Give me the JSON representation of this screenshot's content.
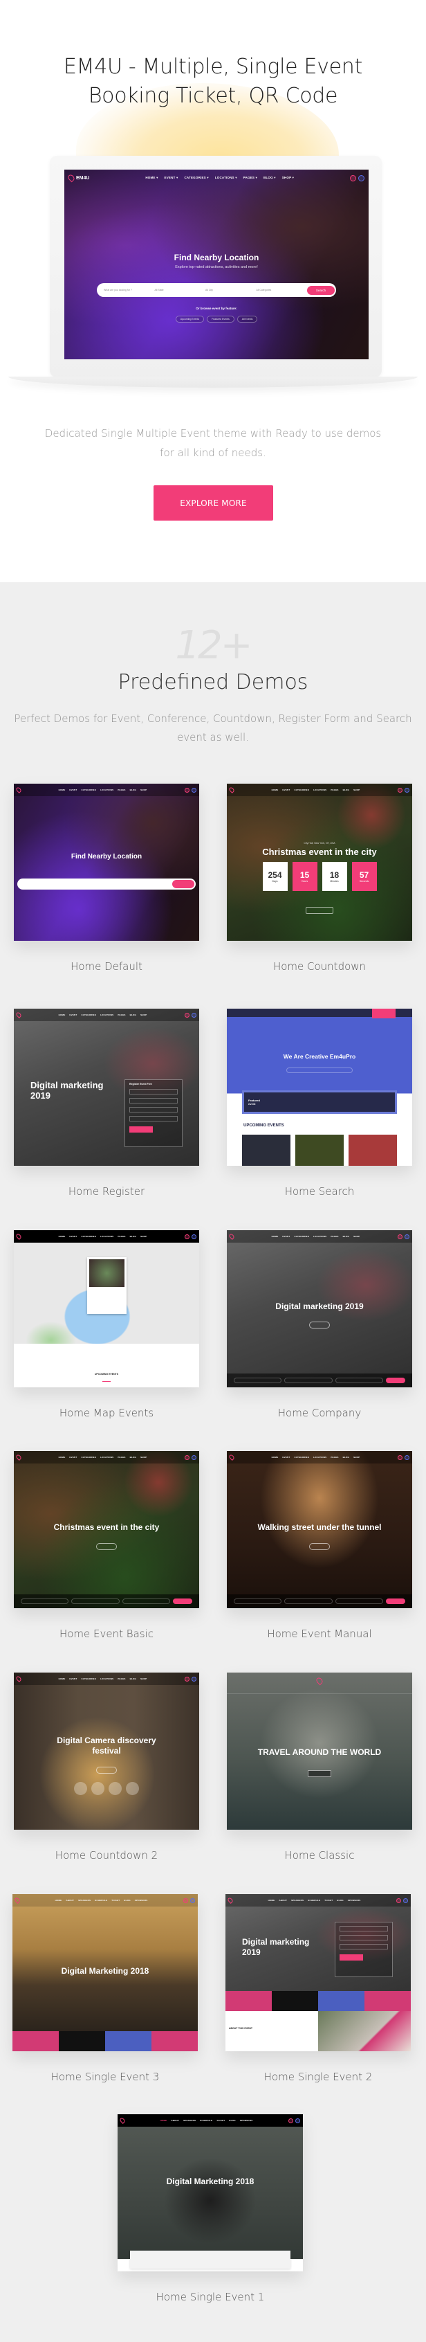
{
  "hero": {
    "title_line1": "EM4U - Multiple, Single Event",
    "title_line2": "Booking Ticket, QR Code",
    "description": "Dedicated Single Multiple Event theme with Ready to use demos for all kind of needs.",
    "explore_button": "EXPLORE MORE",
    "accent_color": "#f23d78",
    "preview": {
      "logo": "EM4U",
      "nav": [
        "HOME ▾",
        "EVENT ▾",
        "CATEGORIES ▾",
        "LOCATIONS ▾",
        "PAGES ▾",
        "BLOG ▾",
        "SHOP ▾"
      ],
      "headline": "Find Nearby Location",
      "subheadline": "Explore top-rated attractions, activities and more!",
      "search_placeholder": "What are you looking for ?",
      "state_select": "All State",
      "city_select": "All City",
      "category_select": "All Categories",
      "search_button": "Search",
      "browse_label": "Or browse event by feature:",
      "chips": [
        "Upcoming Events",
        "Featured Events",
        "All Events"
      ]
    }
  },
  "demos": {
    "count": "12+",
    "title": "Predefined Demos",
    "description": "Perfect Demos for Event, Conference, Countdown, Register Form and Search event as well.",
    "items": [
      {
        "label": "Home Default",
        "headline": "Find Nearby Location"
      },
      {
        "label": "Home Countdown",
        "headline": "Christmas event in the city",
        "location": "City Hall, New York, NY, USA",
        "countdown": [
          {
            "value": "254",
            "unit": "Days"
          },
          {
            "value": "15",
            "unit": "Hours"
          },
          {
            "value": "18",
            "unit": "Minutes"
          },
          {
            "value": "57",
            "unit": "Seconds"
          }
        ]
      },
      {
        "label": "Home Register",
        "headline": "Digital marketing 2019",
        "form_title": "Register Event Free"
      },
      {
        "label": "Home Search",
        "headline": "We Are Creative Em4uPro",
        "section": "UPCOMING EVENTS",
        "featured": "Featured event"
      },
      {
        "label": "Home Map Events",
        "section": "UPCOMING EVENTS"
      },
      {
        "label": "Home Company",
        "headline": "Digital marketing 2019"
      },
      {
        "label": "Home Event Basic",
        "headline": "Christmas event in the city"
      },
      {
        "label": "Home Event Manual",
        "headline": "Walking street under the tunnel"
      },
      {
        "label": "Home Countdown 2",
        "headline": "Digital Camera discovery festival"
      },
      {
        "label": "Home Classic",
        "headline": "TRAVEL AROUND THE WORLD"
      },
      {
        "label": "Home Single Event 3",
        "headline": "Digital Marketing 2018"
      },
      {
        "label": "Home Single Event 2",
        "headline": "Digital marketing 2019",
        "about": "ABOUT THIS EVENT"
      },
      {
        "label": "Home Single Event 1",
        "headline": "Digital Marketing 2018"
      }
    ]
  }
}
